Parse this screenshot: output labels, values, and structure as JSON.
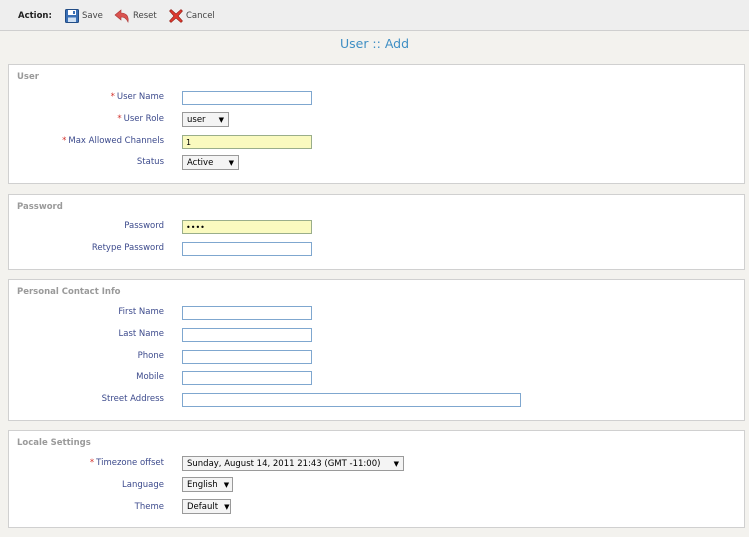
{
  "toolbar": {
    "action_label": "Action:",
    "save_label": "Save",
    "reset_label": "Reset",
    "cancel_label": "Cancel"
  },
  "page_title": "User :: Add",
  "sections": {
    "user": {
      "legend": "User",
      "user_name": {
        "label": "User Name",
        "value": ""
      },
      "user_role": {
        "label": "User Role",
        "value": "user"
      },
      "max_channels": {
        "label": "Max Allowed Channels",
        "value": "1"
      },
      "status": {
        "label": "Status",
        "value": "Active"
      }
    },
    "password": {
      "legend": "Password",
      "password": {
        "label": "Password",
        "value": "••••"
      },
      "retype": {
        "label": "Retype Password",
        "value": ""
      }
    },
    "contact": {
      "legend": "Personal Contact Info",
      "first_name": {
        "label": "First Name",
        "value": ""
      },
      "last_name": {
        "label": "Last Name",
        "value": ""
      },
      "phone": {
        "label": "Phone",
        "value": ""
      },
      "mobile": {
        "label": "Mobile",
        "value": ""
      },
      "street": {
        "label": "Street Address",
        "value": ""
      }
    },
    "locale": {
      "legend": "Locale Settings",
      "timezone": {
        "label": "Timezone offset",
        "value": "Sunday, August 14, 2011 21:43 (GMT -11:00)"
      },
      "language": {
        "label": "Language",
        "value": "English"
      },
      "theme": {
        "label": "Theme",
        "value": "Default"
      }
    }
  },
  "required_marker": "*",
  "icons": {
    "save": "floppy-disk-icon",
    "reset": "undo-arrow-icon",
    "cancel": "red-x-icon",
    "dropdown": "caret-down"
  },
  "colors": {
    "label": "#3c4a8c",
    "title": "#3f8fc4",
    "required": "#d2322d",
    "highlight_field": "#fafabf"
  }
}
